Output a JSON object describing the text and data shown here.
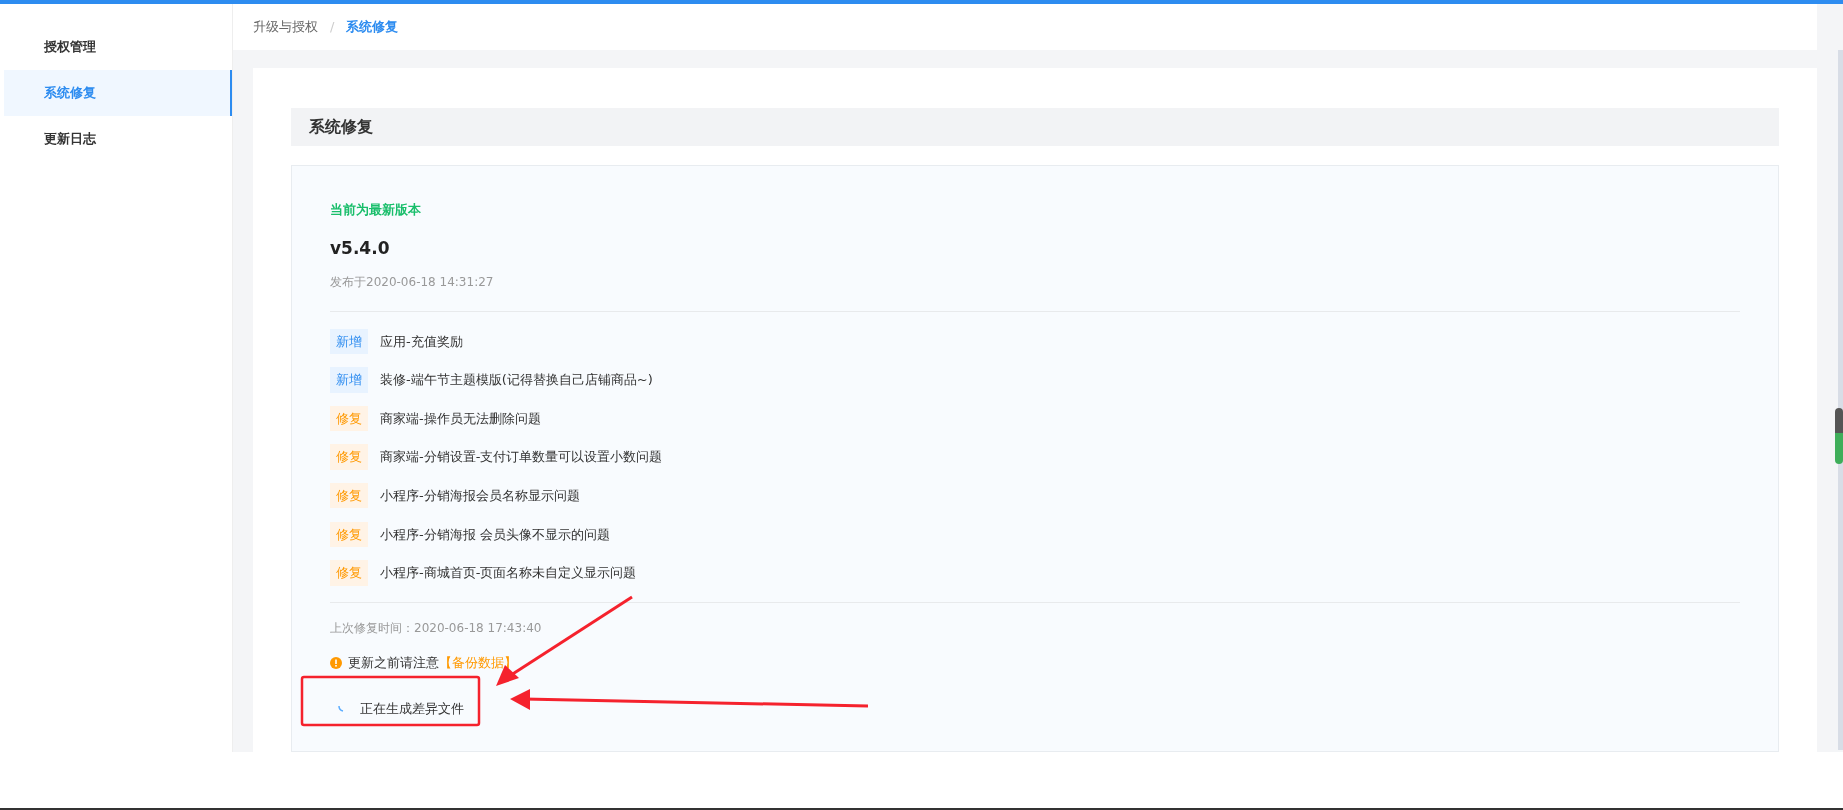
{
  "sidebar": {
    "items": [
      {
        "label": "授权管理",
        "selected": false
      },
      {
        "label": "系统修复",
        "selected": true
      },
      {
        "label": "更新日志",
        "selected": false
      }
    ]
  },
  "breadcrumb": [
    {
      "label": "升级与授权",
      "current": false
    },
    {
      "label": "系统修复",
      "current": true
    }
  ],
  "breadcrumb_separator": "/",
  "section_title": "系统修复",
  "status": "当前为最新版本",
  "version": "v5.4.0",
  "release_date": "发布于2020-06-18 14:31:27",
  "changes": [
    {
      "kind": "new",
      "tag": "新增",
      "text": "应用-充值奖励"
    },
    {
      "kind": "new",
      "tag": "新增",
      "text": "装修-端午节主题模版(记得替换自己店铺商品~)"
    },
    {
      "kind": "fix",
      "tag": "修复",
      "text": "商家端-操作员无法删除问题"
    },
    {
      "kind": "fix",
      "tag": "修复",
      "text": "商家端-分销设置-支付订单数量可以设置小数问题"
    },
    {
      "kind": "fix",
      "tag": "修复",
      "text": "小程序-分销海报会员名称显示问题"
    },
    {
      "kind": "fix",
      "tag": "修复",
      "text": "小程序-分销海报 会员头像不显示的问题"
    },
    {
      "kind": "fix",
      "tag": "修复",
      "text": "小程序-商城首页-页面名称未自定义显示问题"
    }
  ],
  "last_repair": "上次修复时间：2020-06-18 17:43:40",
  "notice": {
    "text": "更新之前请注意",
    "highlight": "【备份数据】"
  },
  "progress_text": "正在生成差异文件"
}
